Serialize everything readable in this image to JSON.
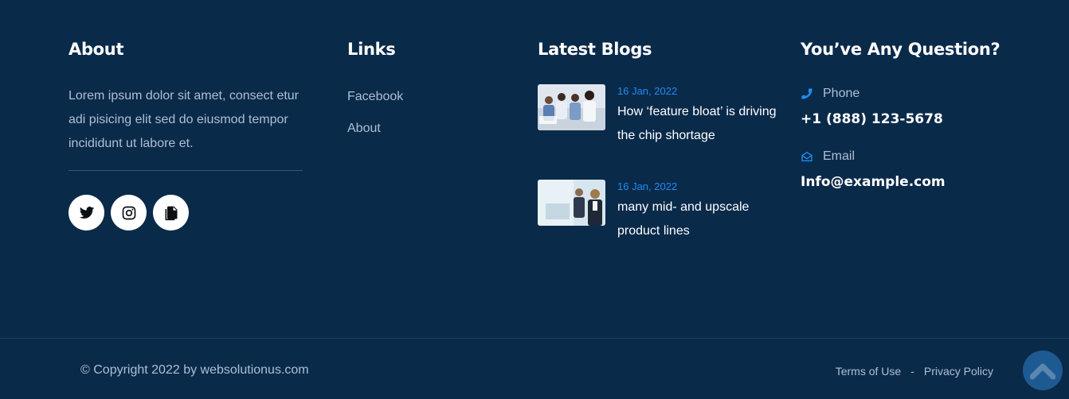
{
  "about": {
    "title": "About",
    "text": "Lorem ipsum dolor sit amet, consect etur adi pisicing elit sed do eiusmod tempor incididunt ut labore et.",
    "social": [
      {
        "icon": "twitter-icon"
      },
      {
        "icon": "instagram-icon"
      },
      {
        "icon": "copy-icon"
      }
    ]
  },
  "links": {
    "title": "Links",
    "items": [
      {
        "label": "Facebook"
      },
      {
        "label": "About"
      }
    ]
  },
  "blogs": {
    "title": "Latest Blogs",
    "items": [
      {
        "date": "16 Jan, 2022",
        "title": "How ‘feature bloat’ is driving the chip shortage"
      },
      {
        "date": "16 Jan, 2022",
        "title": "many mid- and upscale product lines"
      }
    ]
  },
  "contact": {
    "title": "You’ve Any Question?",
    "phone_label": "Phone",
    "phone_value": "+1 (888) 123-5678",
    "email_label": "Email",
    "email_value": "Info@example.com"
  },
  "bottom": {
    "copyright": "© Copyright 2022 by websolutionus.com",
    "terms": "Terms of Use",
    "separator": "-",
    "privacy": "Privacy Policy"
  },
  "colors": {
    "background": "#0a2a4a",
    "accent": "#1e8cf0",
    "muted_text": "#aebfd4",
    "scroll_button": "#1d5a92"
  }
}
